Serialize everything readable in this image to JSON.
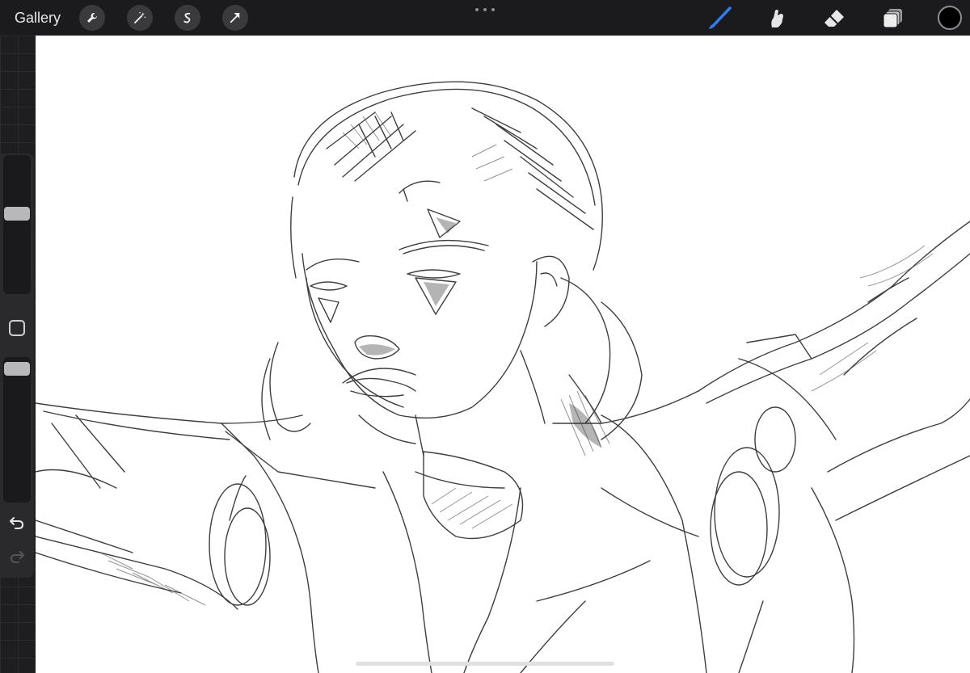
{
  "topbar": {
    "gallery_label": "Gallery",
    "left_tools": [
      "wrench-icon",
      "magic-wand-icon",
      "selection-icon",
      "transform-arrow-icon"
    ],
    "right_tools": [
      "brush-icon",
      "smudge-icon",
      "eraser-icon",
      "layers-icon"
    ],
    "active_tool": "brush-icon",
    "accent_color": "#2f7cf6",
    "current_color": "#000000"
  },
  "sidebar": {
    "brush_size_level": 0.6,
    "opacity_level": 0.95,
    "icons": [
      "modify-square-icon",
      "undo-icon",
      "redo-icon"
    ]
  }
}
